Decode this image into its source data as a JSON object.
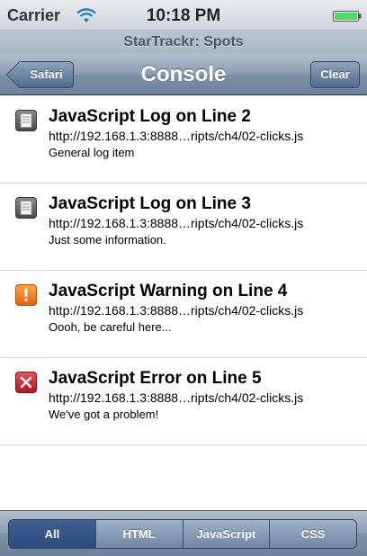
{
  "status": {
    "carrier": "Carrier",
    "time": "10:18 PM"
  },
  "page": {
    "title": "StarTrackr: Spots"
  },
  "nav": {
    "title": "Console",
    "back_label": "Safari",
    "clear_label": "Clear"
  },
  "logs": [
    {
      "kind": "log",
      "icon": "log-icon",
      "title": "JavaScript Log on Line 2",
      "url": "http://192.168.1.3:8888…ripts/ch4/02-clicks.js",
      "message": "General log item"
    },
    {
      "kind": "log",
      "icon": "log-icon",
      "title": "JavaScript Log on Line 3",
      "url": "http://192.168.1.3:8888…ripts/ch4/02-clicks.js",
      "message": "Just some information."
    },
    {
      "kind": "warning",
      "icon": "warning-icon",
      "title": "JavaScript Warning on Line 4",
      "url": "http://192.168.1.3:8888…ripts/ch4/02-clicks.js",
      "message": "Oooh, be careful here..."
    },
    {
      "kind": "error",
      "icon": "error-icon",
      "title": "JavaScript Error on Line 5",
      "url": "http://192.168.1.3:8888…ripts/ch4/02-clicks.js",
      "message": "We've got a problem!"
    }
  ],
  "filters": {
    "all": "All",
    "html": "HTML",
    "javascript": "JavaScript",
    "css": "CSS",
    "selected": "All"
  },
  "colors": {
    "nav_accent": "#6d829b",
    "warning": "#f07d1d",
    "error": "#c8202c",
    "battery": "#4cd964"
  }
}
